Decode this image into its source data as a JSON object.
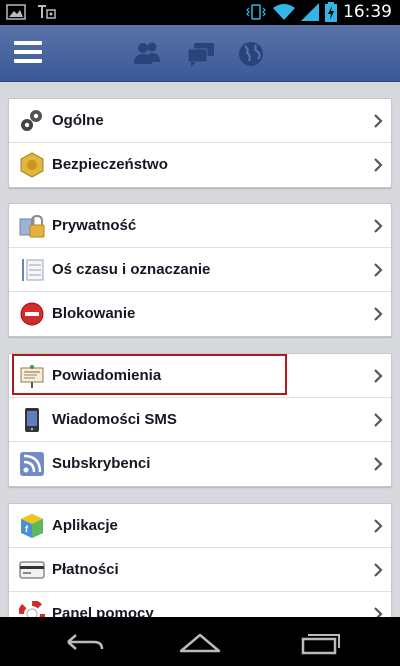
{
  "status_bar": {
    "time": "16:39",
    "icons": [
      "image-icon",
      "notification-icon",
      "vibrate-icon",
      "wifi-icon",
      "signal-icon",
      "battery-charging-icon"
    ]
  },
  "app_bar": {
    "icons": [
      "menu-icon",
      "friends-icon",
      "messages-icon",
      "globe-icon"
    ],
    "brand_color": "#3b5998"
  },
  "groups": [
    {
      "items": [
        {
          "label": "Ogólne",
          "icon": "gears-icon"
        },
        {
          "label": "Bezpieczeństwo",
          "icon": "shield-badge-icon"
        }
      ]
    },
    {
      "items": [
        {
          "label": "Prywatność",
          "icon": "lock-icon"
        },
        {
          "label": "Oś czasu i oznaczanie",
          "icon": "timeline-icon"
        },
        {
          "label": "Blokowanie",
          "icon": "block-icon"
        }
      ]
    },
    {
      "items": [
        {
          "label": "Powiadomienia",
          "icon": "notice-board-icon"
        },
        {
          "label": "Wiadomości SMS",
          "icon": "phone-icon"
        },
        {
          "label": "Subskrybenci",
          "icon": "rss-icon"
        }
      ]
    },
    {
      "items": [
        {
          "label": "Aplikacje",
          "icon": "apps-cube-icon"
        },
        {
          "label": "Płatności",
          "icon": "credit-card-icon"
        },
        {
          "label": "Panel pomocy",
          "icon": "lifebuoy-icon"
        }
      ]
    }
  ],
  "highlighted_item": "Powiadomienia",
  "highlight_color": "#b01a1a",
  "nav_bar": {
    "icons": [
      "back-icon",
      "home-icon",
      "recent-apps-icon"
    ]
  }
}
